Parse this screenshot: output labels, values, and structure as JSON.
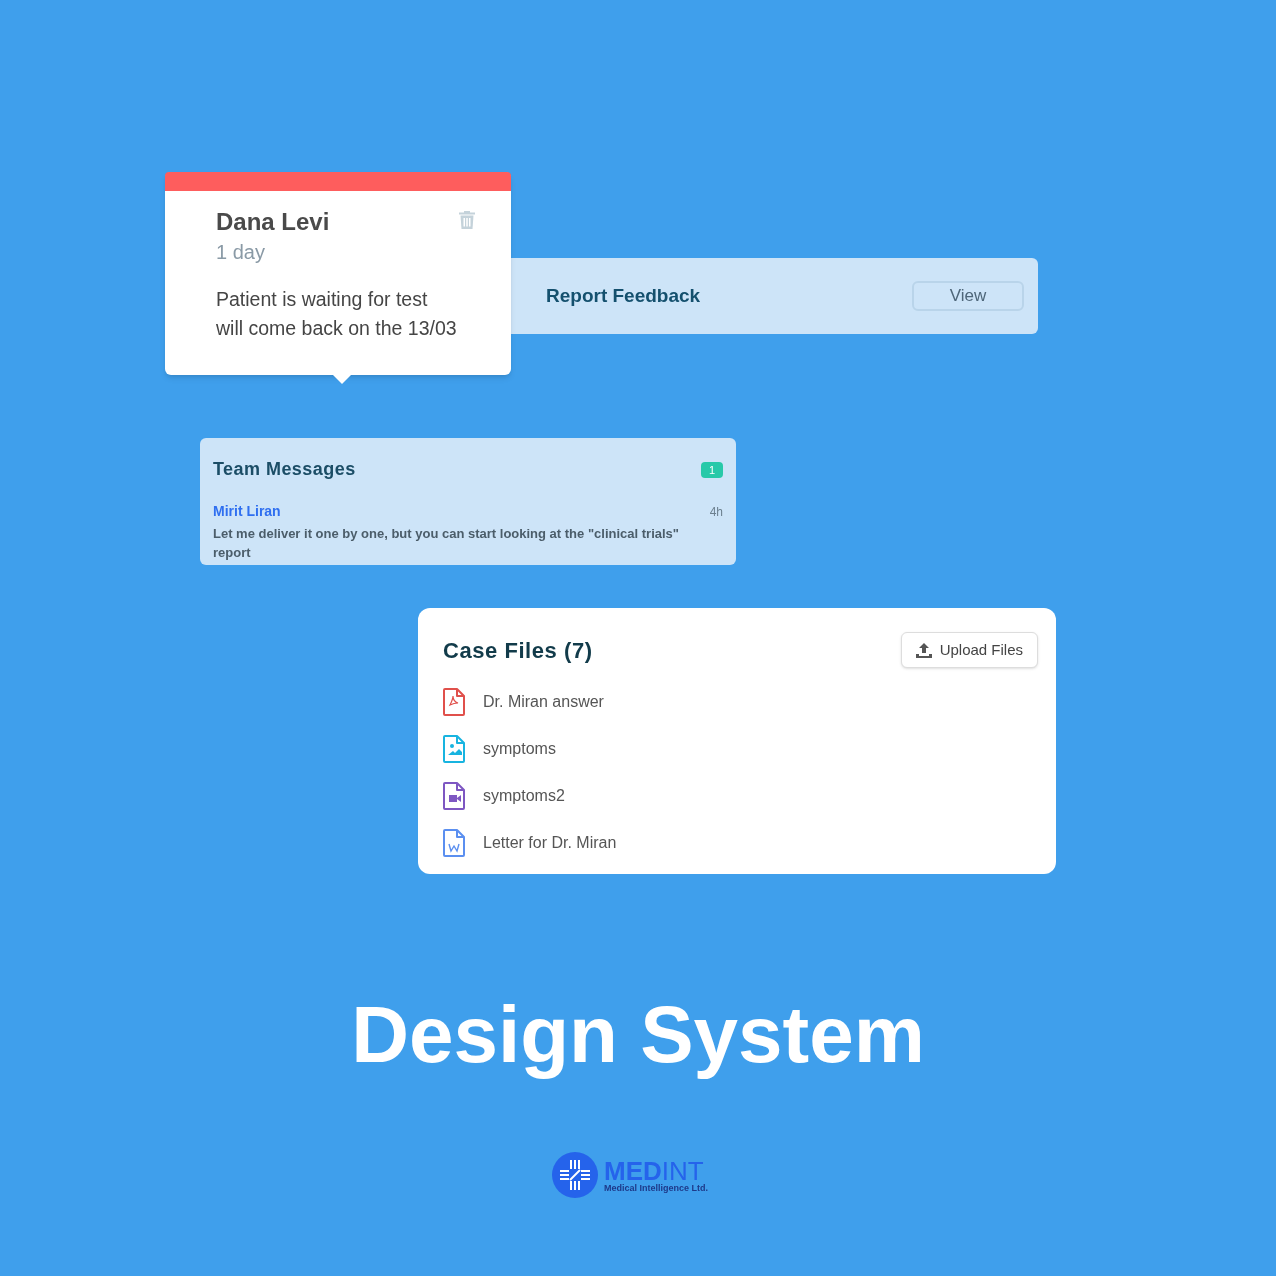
{
  "note": {
    "name": "Dana Levi",
    "age": "1 day",
    "text": "Patient is waiting for test\nwill come back on the 13/03"
  },
  "report": {
    "title": "Report Feedback",
    "button": "View"
  },
  "team_messages": {
    "title": "Team Messages",
    "badge": "1",
    "messages": [
      {
        "author": "Mirit Liran",
        "time": "4h",
        "text": "Let me deliver it one by one, but you can start looking at the \"clinical trials\" report"
      }
    ]
  },
  "case_files": {
    "title": "Case Files (7)",
    "button": "Upload Files",
    "files": [
      {
        "kind": "pdf",
        "name": "Dr. Miran answer"
      },
      {
        "kind": "image",
        "name": "symptoms"
      },
      {
        "kind": "video",
        "name": "symptoms2"
      },
      {
        "kind": "word",
        "name": "Letter for Dr. Miran"
      }
    ]
  },
  "headline": "Design System",
  "logo": {
    "name": "**MED**INT",
    "tagline": "Medical Intelligence Ltd."
  }
}
